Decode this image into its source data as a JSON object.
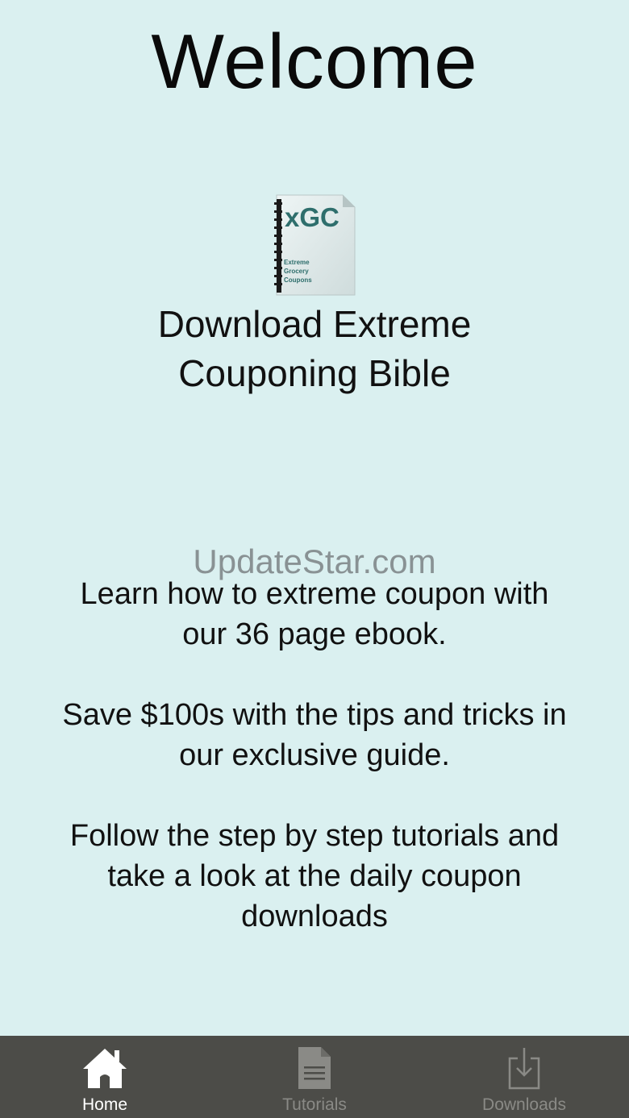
{
  "header": {
    "title": "Welcome"
  },
  "promo": {
    "book_cover_icon": "ebook-cover-icon",
    "book_cover_text_large": "xGC",
    "book_cover_text_lines": [
      "Extreme",
      "Grocery",
      "Coupons"
    ],
    "download_line1": "Download Extreme",
    "download_line2": "Couponing Bible"
  },
  "watermark": {
    "text": "UpdateStar.com"
  },
  "description": {
    "p1_line1": "Learn how to extreme coupon with",
    "p1_line2": "our 36 page ebook.",
    "p2_line1": "Save $100s with the tips and tricks in",
    "p2_line2": "our exclusive guide.",
    "p3_line1": "Follow the step by step tutorials and",
    "p3_line2": "take a look at the daily coupon",
    "p3_line3": "downloads"
  },
  "tabbar": {
    "tabs": [
      {
        "label": "Home",
        "icon": "home-icon",
        "active": true
      },
      {
        "label": "Tutorials",
        "icon": "document-icon",
        "active": false
      },
      {
        "label": "Downloads",
        "icon": "download-icon",
        "active": false
      }
    ]
  },
  "colors": {
    "background": "#daf0f0",
    "tabbar": "#4c4c48",
    "tab_active": "#ffffff",
    "tab_inactive": "#8a8a86"
  }
}
